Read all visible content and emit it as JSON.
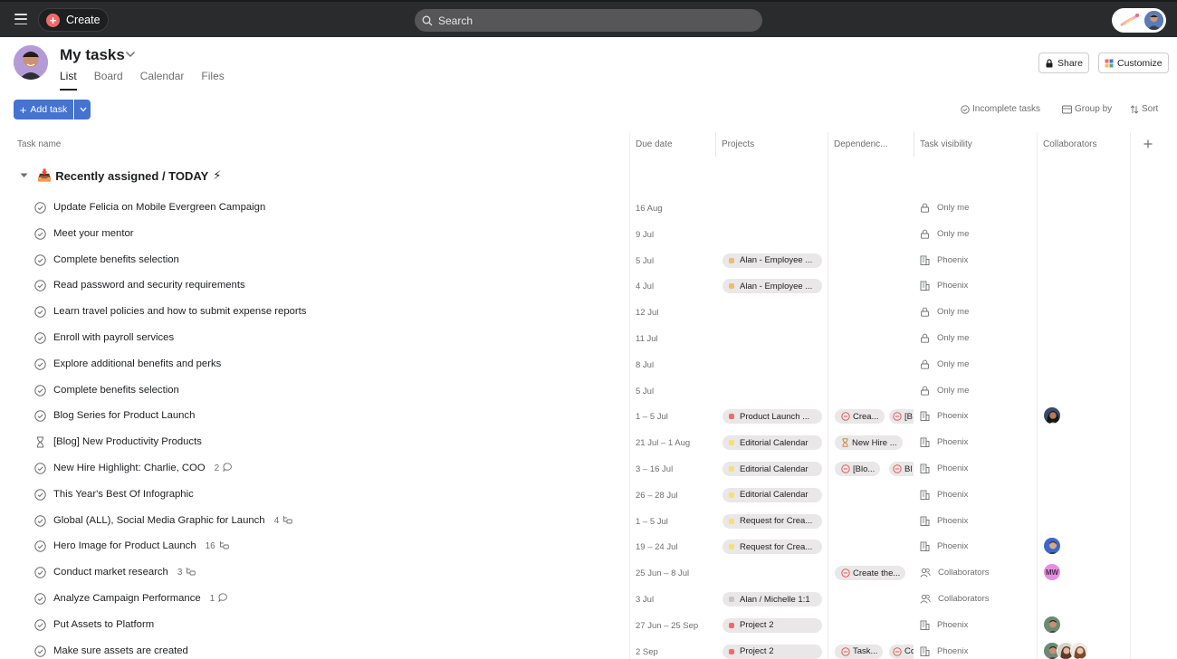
{
  "topbar": {
    "create_label": "Create",
    "search_placeholder": "Search"
  },
  "header": {
    "title": "My tasks",
    "tabs": [
      "List",
      "Board",
      "Calendar",
      "Files"
    ],
    "share_label": "Share",
    "customize_label": "Customize"
  },
  "toolbar": {
    "add_task_label": "Add task",
    "incomplete_label": "Incomplete tasks",
    "group_by_label": "Group by",
    "sort_label": "Sort"
  },
  "columns": {
    "task_name": "Task name",
    "due_date": "Due date",
    "projects": "Projects",
    "dependencies": "Dependenc...",
    "task_visibility": "Task visibility",
    "collaborators": "Collaborators"
  },
  "section": {
    "title": "Recently assigned / TODAY",
    "emoji_before": "📥",
    "emoji_after": "⚡"
  },
  "colors": {
    "accent": "#4573d2",
    "create_plus": "#f06a6a",
    "topbar": "#2a2b2d"
  },
  "tasks": [
    {
      "name": "Update Felicia on Mobile Evergreen Campaign",
      "due": "16 Aug",
      "visibility": "Only me",
      "vis_icon": "lock-icon"
    },
    {
      "name": "Meet your mentor",
      "due": "9 Jul",
      "visibility": "Only me",
      "vis_icon": "lock-icon"
    },
    {
      "name": "Complete benefits selection",
      "due": "5 Jul",
      "project": "Alan - Employee ...",
      "project_color": "#f1bd6c",
      "visibility": "Phoenix",
      "vis_icon": "building-icon"
    },
    {
      "name": "Read password and security requirements",
      "due": "4 Jul",
      "project": "Alan - Employee ...",
      "project_color": "#f1bd6c",
      "visibility": "Phoenix",
      "vis_icon": "building-icon"
    },
    {
      "name": "Learn travel policies and how to submit expense reports",
      "due": "12 Jul",
      "visibility": "Only me",
      "vis_icon": "lock-icon"
    },
    {
      "name": "Enroll with payroll services",
      "due": "11 Jul",
      "visibility": "Only me",
      "vis_icon": "lock-icon"
    },
    {
      "name": "Explore additional benefits and perks",
      "due": "8 Jul",
      "visibility": "Only me",
      "vis_icon": "lock-icon"
    },
    {
      "name": "Complete benefits selection",
      "due": "5 Jul",
      "visibility": "Only me",
      "vis_icon": "lock-icon"
    },
    {
      "name": "Blog Series for Product Launch",
      "due": "1 – 5 Jul",
      "project": "Product Launch ...",
      "project_color": "#f06a6a",
      "dep1": "Crea...",
      "dep2": "[B",
      "visibility": "Phoenix",
      "vis_icon": "building-icon",
      "collaborators": [
        "avatar-woman-dark"
      ]
    },
    {
      "name": "[Blog] New Productivity Products",
      "due": "21 Jul – 1 Aug",
      "project": "Editorial Calendar",
      "project_color": "#f8df72",
      "dep1": "New Hire ...",
      "dep1_icon": "hourglass-icon",
      "visibility": "Phoenix",
      "vis_icon": "building-icon",
      "check_icon": "hourglass-icon"
    },
    {
      "name": "New Hire Highlight: Charlie, COO",
      "meta": "2",
      "meta_icon": "comment-icon",
      "due": "3 – 16 Jul",
      "project": "Editorial Calendar",
      "project_color": "#f8df72",
      "dep1": "[Blo...",
      "dep2": "Bl",
      "visibility": "Phoenix",
      "vis_icon": "building-icon"
    },
    {
      "name": "This Year's Best Of Infographic",
      "due": "26 – 28 Jul",
      "project": "Editorial Calendar",
      "project_color": "#f8df72",
      "visibility": "Phoenix",
      "vis_icon": "building-icon"
    },
    {
      "name": "Global (ALL), Social Media Graphic for Launch",
      "meta": "4",
      "meta_icon": "subtask-icon",
      "due": "1 – 5 Jul",
      "project": "Request for Crea...",
      "project_color": "#f8df72",
      "visibility": "Phoenix",
      "vis_icon": "building-icon"
    },
    {
      "name": "Hero Image for Product Launch",
      "meta": "16",
      "meta_icon": "subtask-icon",
      "due": "19 – 24 Jul",
      "project": "Request for Crea...",
      "project_color": "#f8df72",
      "visibility": "Phoenix",
      "vis_icon": "building-icon",
      "collaborators": [
        "avatar-man-blue"
      ]
    },
    {
      "name": "Conduct market research",
      "meta": "3",
      "meta_icon": "subtask-icon",
      "due": "25 Jun – 8 Jul",
      "dep1": "Create the...",
      "visibility": "Collaborators",
      "vis_icon": "people-icon",
      "collaborators": [
        "MW"
      ]
    },
    {
      "name": "Analyze Campaign Performance",
      "meta": "1",
      "meta_icon": "comment-icon",
      "due": "3 Jul",
      "project": "Alan / Michelle 1:1",
      "project_color": "#c7c4c4",
      "visibility": "Collaborators",
      "vis_icon": "people-icon"
    },
    {
      "name": "Put Assets to Platform",
      "due": "27 Jun – 25 Sep",
      "project": "Project 2",
      "project_color": "#f06a6a",
      "visibility": "Phoenix",
      "vis_icon": "building-icon",
      "collaborators": [
        "avatar-man-green"
      ]
    },
    {
      "name": "Make sure assets are created",
      "due": "2 Sep",
      "project": "Project 2",
      "project_color": "#f06a6a",
      "dep1": "Task...",
      "dep2": "Cc",
      "visibility": "Phoenix",
      "vis_icon": "building-icon",
      "collaborators": [
        "avatar-man-green",
        "avatar-woman-a",
        "avatar-woman-b"
      ]
    }
  ]
}
